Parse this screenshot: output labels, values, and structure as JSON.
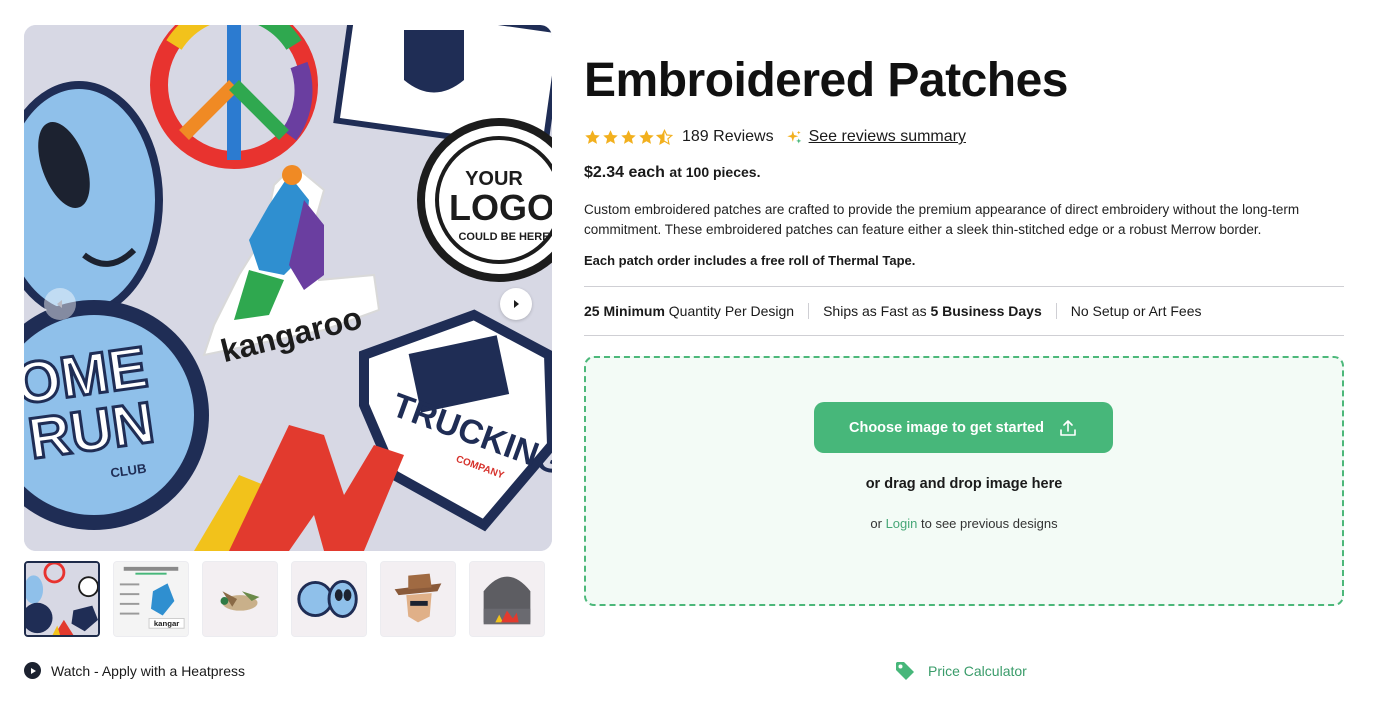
{
  "product": {
    "title": "Embroidered Patches",
    "rating_value": 4.5,
    "reviews_count_label": "189 Reviews",
    "reviews_summary_link": "See reviews summary",
    "price": "$2.34 each",
    "price_suffix": "at 100 pieces.",
    "description": "Custom embroidered patches are crafted to provide the premium appearance of direct embroidery without the long-term commitment. These embroidered patches can feature either a sleek thin-stitched edge or a robust Merrow border.",
    "tape_note": "Each patch order includes a free roll of Thermal Tape."
  },
  "features": [
    {
      "bold": "25 Minimum",
      "text": " Quantity Per Design"
    },
    {
      "text": "Ships as Fast as ",
      "bold": "5 Business Days"
    },
    {
      "text": "No Setup or Art Fees"
    }
  ],
  "upload": {
    "button_label": "Choose image to get started",
    "drag_text": "or drag and drop image here",
    "login_prefix": "or ",
    "login_link": "Login",
    "login_suffix": " to see previous designs"
  },
  "gallery": {
    "main_image_text": {
      "kangaroo": "kangaroo",
      "logo_top": "YOUR",
      "logo_mid": "LOGO",
      "logo_bottom": "COULD BE HERE",
      "homerun_1": "OME",
      "homerun_2": "RUN",
      "homerun_3": "CLUB",
      "trucking": "TRUCKING",
      "trucking_sub": "COMPANY"
    },
    "thumbnails": [
      {
        "name": "patch-collage"
      },
      {
        "name": "patch-anatomy"
      },
      {
        "name": "duck-patch"
      },
      {
        "name": "alien-homerun-patch"
      },
      {
        "name": "cowboy-patch"
      },
      {
        "name": "beanie-patch"
      }
    ],
    "watch_label": "Watch - Apply with a Heatpress"
  },
  "price_calculator_label": "Price Calculator",
  "colors": {
    "accent_green": "#47b77a",
    "star_gold": "#f2b01e",
    "dashed_border": "#4cb87a"
  }
}
